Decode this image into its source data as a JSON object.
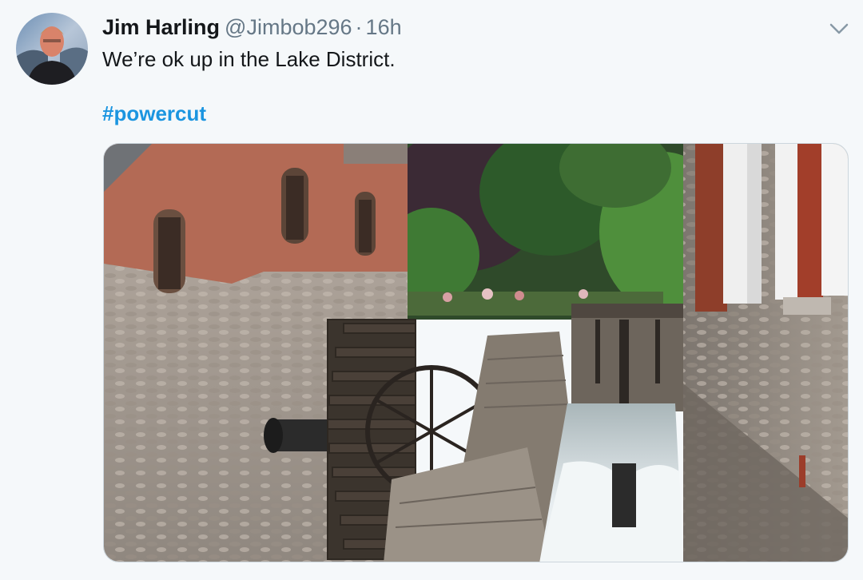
{
  "tweet": {
    "author_name": "Jim Harling",
    "author_handle": "@Jimbob296",
    "separator": "·",
    "time": "16h",
    "text": "We’re ok up in the Lake District.",
    "hashtag": "#powercut"
  },
  "icons": {
    "menu": "chevron-down-icon"
  },
  "colors": {
    "background": "#f5f8fa",
    "link": "#1b95e0",
    "text": "#14171a",
    "muted": "#657786"
  }
}
